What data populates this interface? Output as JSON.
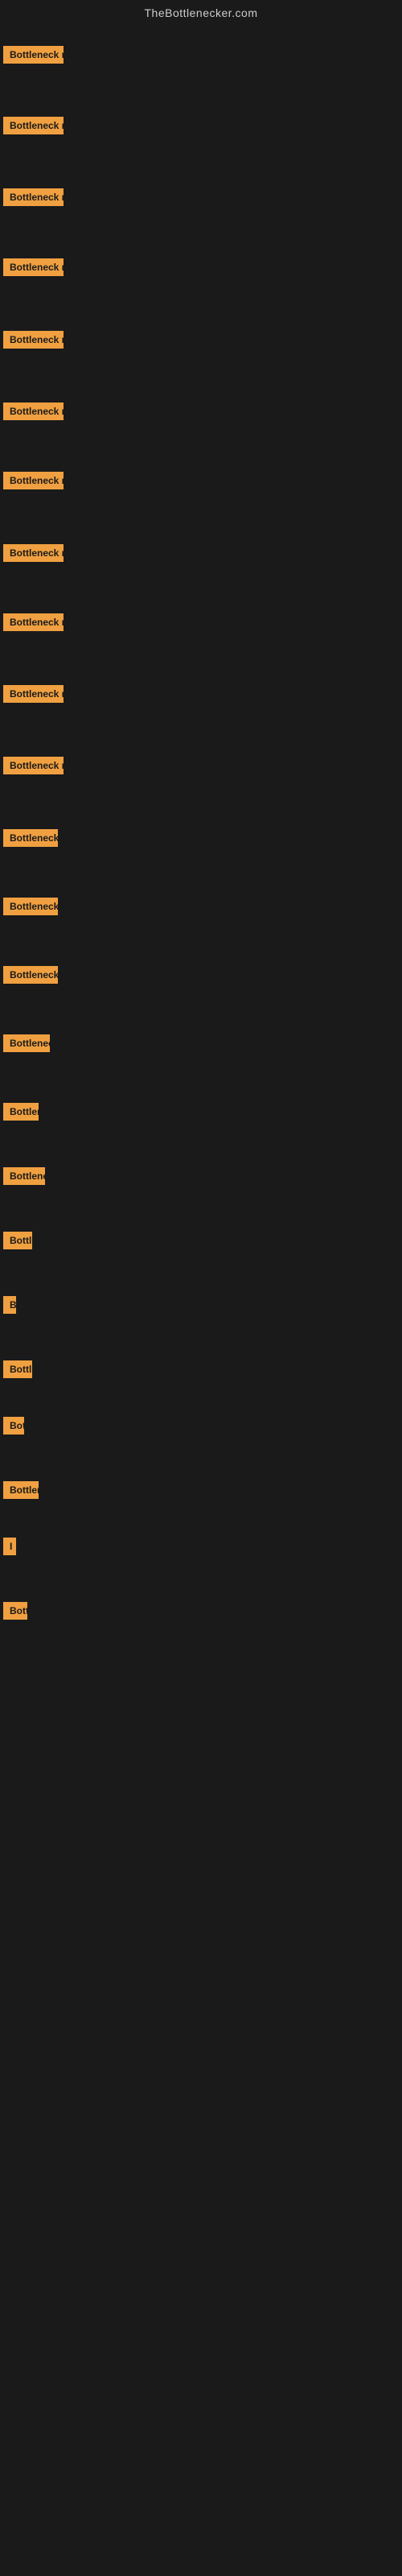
{
  "site": {
    "title": "TheBottlenecker.com"
  },
  "bars": [
    {
      "id": 1,
      "label": "Bottleneck result",
      "width": 75
    },
    {
      "id": 2,
      "label": "Bottleneck result",
      "width": 75
    },
    {
      "id": 3,
      "label": "Bottleneck result",
      "width": 75
    },
    {
      "id": 4,
      "label": "Bottleneck result",
      "width": 75
    },
    {
      "id": 5,
      "label": "Bottleneck result",
      "width": 75
    },
    {
      "id": 6,
      "label": "Bottleneck result",
      "width": 75
    },
    {
      "id": 7,
      "label": "Bottleneck result",
      "width": 75
    },
    {
      "id": 8,
      "label": "Bottleneck result",
      "width": 75
    },
    {
      "id": 9,
      "label": "Bottleneck result",
      "width": 75
    },
    {
      "id": 10,
      "label": "Bottleneck result",
      "width": 75
    },
    {
      "id": 11,
      "label": "Bottleneck result",
      "width": 75
    },
    {
      "id": 12,
      "label": "Bottleneck resu",
      "width": 68
    },
    {
      "id": 13,
      "label": "Bottleneck resu",
      "width": 68
    },
    {
      "id": 14,
      "label": "Bottleneck resu",
      "width": 68
    },
    {
      "id": 15,
      "label": "Bottleneck r",
      "width": 58
    },
    {
      "id": 16,
      "label": "Bottlen",
      "width": 44
    },
    {
      "id": 17,
      "label": "Bottleneck",
      "width": 52
    },
    {
      "id": 18,
      "label": "Bottl",
      "width": 36
    },
    {
      "id": 19,
      "label": "B",
      "width": 16
    },
    {
      "id": 20,
      "label": "Bottl",
      "width": 36
    },
    {
      "id": 21,
      "label": "Bot",
      "width": 26
    },
    {
      "id": 22,
      "label": "Bottlen",
      "width": 44
    },
    {
      "id": 23,
      "label": "I",
      "width": 10
    },
    {
      "id": 24,
      "label": "Bott",
      "width": 30
    }
  ],
  "colors": {
    "bar_bg": "#f0a040",
    "page_bg": "#1a1a1a",
    "title": "#cccccc"
  }
}
